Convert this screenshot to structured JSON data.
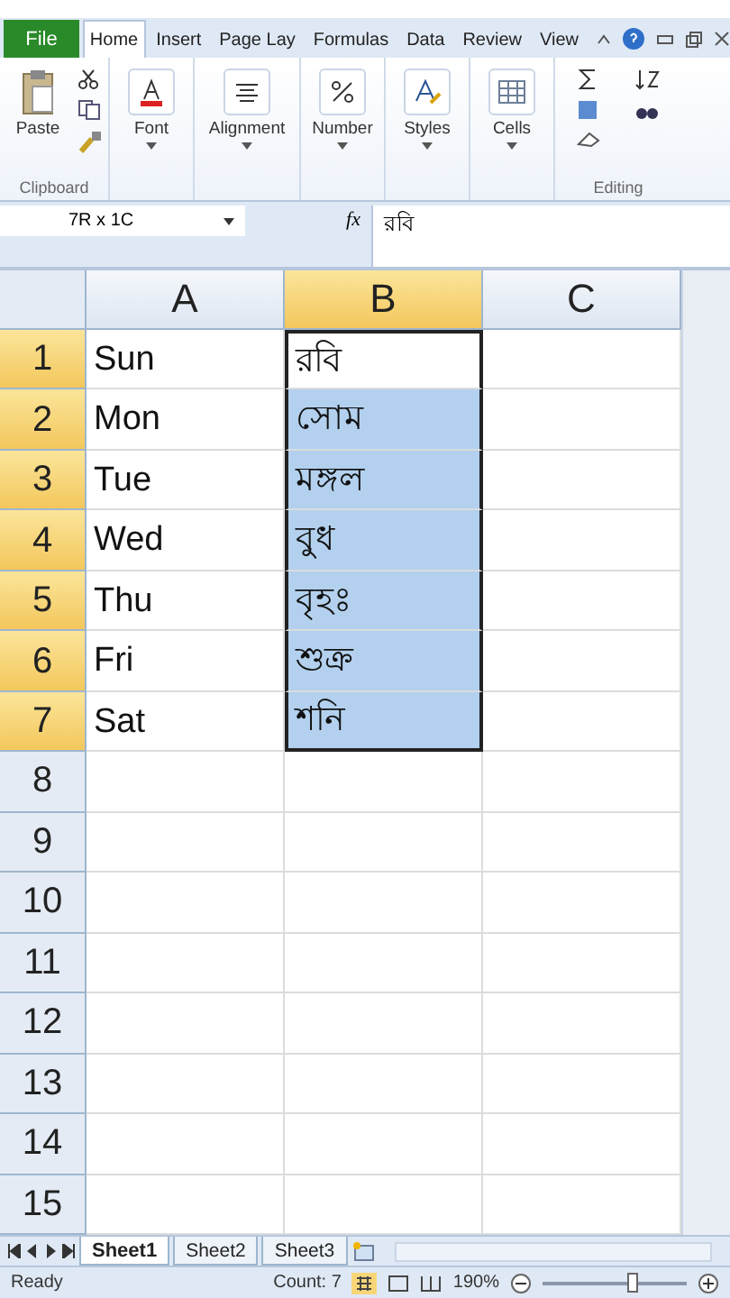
{
  "ribbon_tabs": [
    {
      "label": "File",
      "kind": "file",
      "selected": false
    },
    {
      "label": "Home",
      "kind": "tab",
      "selected": true
    },
    {
      "label": "Insert",
      "kind": "tab",
      "selected": false
    },
    {
      "label": "Page Lay",
      "kind": "tab",
      "selected": false
    },
    {
      "label": "Formulas",
      "kind": "tab",
      "selected": false
    },
    {
      "label": "Data",
      "kind": "tab",
      "selected": false
    },
    {
      "label": "Review",
      "kind": "tab",
      "selected": false
    },
    {
      "label": "View",
      "kind": "tab",
      "selected": false
    }
  ],
  "ribbon_groups": [
    {
      "kind": "clipboard",
      "buttons": [
        "Paste"
      ],
      "label": "Clipboard"
    },
    {
      "kind": "big",
      "buttons": [
        "Font"
      ]
    },
    {
      "kind": "big",
      "buttons": [
        "Alignment"
      ]
    },
    {
      "kind": "big",
      "buttons": [
        "Number"
      ]
    },
    {
      "kind": "big",
      "buttons": [
        "Styles"
      ]
    },
    {
      "kind": "big",
      "buttons": [
        "Cells"
      ]
    },
    {
      "kind": "editing",
      "label": "Editing"
    }
  ],
  "formula_bar": {
    "name_box": "7R x 1C",
    "fx": "fx",
    "value": "রবি"
  },
  "columns": [
    {
      "label": "A",
      "selected": false
    },
    {
      "label": "B",
      "selected": true
    },
    {
      "label": "C",
      "selected": false
    }
  ],
  "rows": [
    {
      "number": "1",
      "selected": true,
      "cells": [
        {
          "text": "Sun",
          "selected": false,
          "active": false
        },
        {
          "text": "রবি",
          "selected": true,
          "active": true
        }
      ]
    },
    {
      "number": "2",
      "selected": true,
      "cells": [
        {
          "text": "Mon",
          "selected": false,
          "active": false
        },
        {
          "text": "সোম",
          "selected": true,
          "active": false
        }
      ]
    },
    {
      "number": "3",
      "selected": true,
      "cells": [
        {
          "text": "Tue",
          "selected": false,
          "active": false
        },
        {
          "text": "মঙ্গল",
          "selected": true,
          "active": false
        }
      ]
    },
    {
      "number": "4",
      "selected": true,
      "cells": [
        {
          "text": "Wed",
          "selected": false,
          "active": false
        },
        {
          "text": "বুধ",
          "selected": true,
          "active": false
        }
      ]
    },
    {
      "number": "5",
      "selected": true,
      "cells": [
        {
          "text": "Thu",
          "selected": false,
          "active": false
        },
        {
          "text": "বৃহঃ",
          "selected": true,
          "active": false
        }
      ]
    },
    {
      "number": "6",
      "selected": true,
      "cells": [
        {
          "text": "Fri",
          "selected": false,
          "active": false
        },
        {
          "text": "শুক্র",
          "selected": true,
          "active": false
        }
      ]
    },
    {
      "number": "7",
      "selected": true,
      "cells": [
        {
          "text": "Sat",
          "selected": false,
          "active": false
        },
        {
          "text": "শনি",
          "selected": true,
          "active": false
        }
      ]
    },
    {
      "number": "8",
      "selected": false,
      "cells": []
    },
    {
      "number": "9",
      "selected": false,
      "cells": []
    },
    {
      "number": "10",
      "selected": false,
      "cells": []
    },
    {
      "number": "11",
      "selected": false,
      "cells": []
    },
    {
      "number": "12",
      "selected": false,
      "cells": []
    },
    {
      "number": "13",
      "selected": false,
      "cells": []
    },
    {
      "number": "14",
      "selected": false,
      "cells": []
    },
    {
      "number": "15",
      "selected": false,
      "cells": []
    }
  ],
  "sheet_tabs": [
    {
      "label": "Sheet1",
      "selected": true
    },
    {
      "label": "Sheet2",
      "selected": false
    },
    {
      "label": "Sheet3",
      "selected": false
    }
  ],
  "status_bar": {
    "status": "Ready",
    "count": "Count: 7",
    "zoom": "190%",
    "level": 0.62
  }
}
